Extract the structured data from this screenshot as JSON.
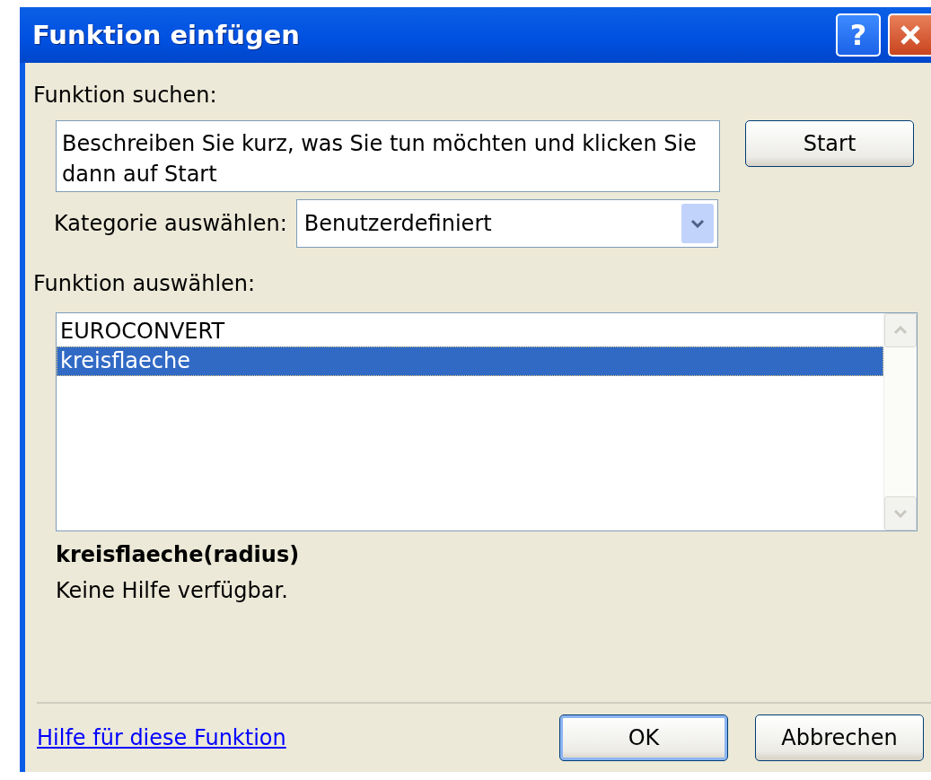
{
  "window": {
    "title": "Funktion einfügen",
    "help_button": "?"
  },
  "search": {
    "label": "Funktion suchen:",
    "value": "Beschreiben Sie kurz, was Sie tun möchten und klicken Sie dann auf Start",
    "button": "Start"
  },
  "category": {
    "label": "Kategorie auswählen:",
    "value": "Benutzerdefiniert"
  },
  "function_list": {
    "label": "Funktion auswählen:",
    "items": [
      {
        "name": "EUROCONVERT",
        "selected": false
      },
      {
        "name": "kreisflaeche",
        "selected": true
      }
    ]
  },
  "signature": "kreisflaeche(radius)",
  "description": "Keine Hilfe verfügbar.",
  "help_link": "Hilfe für diese Funktion",
  "buttons": [
    {
      "label": "OK",
      "default": true
    },
    {
      "label": "Abbrechen",
      "default": false
    }
  ]
}
